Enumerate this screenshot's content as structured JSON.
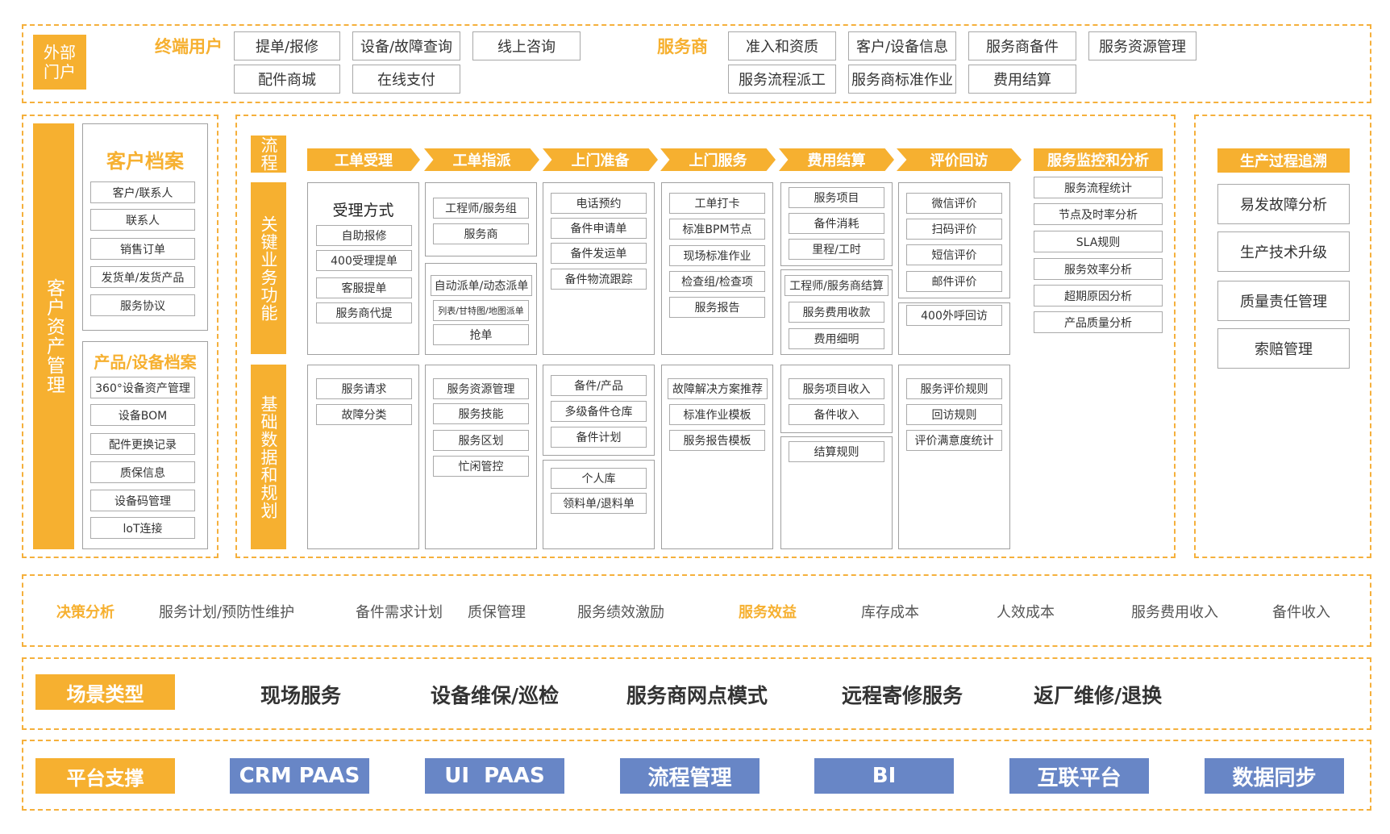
{
  "portal": {
    "label": "外部门户",
    "end_user": {
      "title": "终端用户",
      "items": [
        "提单/报修",
        "设备/故障查询",
        "线上咨询",
        "配件商城",
        "在线支付"
      ]
    },
    "provider": {
      "title": "服务商",
      "items": [
        "准入和资质",
        "客户/设备信息",
        "服务商备件",
        "服务资源管理",
        "服务流程派工",
        "服务商标准作业",
        "费用结算"
      ]
    }
  },
  "asset": {
    "label": "客户资产管理",
    "customer": {
      "title": "客户档案",
      "items": [
        "客户/联系人",
        "联系人",
        "销售订单",
        "发货单/发货产品",
        "服务协议"
      ]
    },
    "product": {
      "title": "产品/设备档案",
      "items": [
        "360°设备资产管理",
        "设备BOM",
        "配件更换记录",
        "质保信息",
        "设备码管理",
        "loT连接"
      ]
    }
  },
  "process": {
    "side_labels": [
      "流程",
      "关键业务功能",
      "基础数据和规划"
    ],
    "stages": [
      "工单受理",
      "工单指派",
      "上门准备",
      "上门服务",
      "费用结算",
      "评价回访"
    ],
    "key": {
      "c1": {
        "heading": "受理方式",
        "items": [
          "自助报修",
          "400受理提单",
          "客服提单",
          "服务商代提"
        ]
      },
      "c2": {
        "top": [
          "工程师/服务组",
          "服务商"
        ],
        "bottom": [
          "自动派单/动态派单",
          "列表/甘特图/地图派单",
          "抢单"
        ]
      },
      "c3": {
        "items": [
          "电话预约",
          "备件申请单",
          "备件发运单",
          "备件物流跟踪"
        ]
      },
      "c4": {
        "items": [
          "工单打卡",
          "标准BPM节点",
          "现场标准作业",
          "检查组/检查项",
          "服务报告"
        ]
      },
      "c5": {
        "top": [
          "服务项目",
          "备件消耗",
          "里程/工时"
        ],
        "bottom": [
          "工程师/服务商结算",
          "服务费用收款",
          "费用细明"
        ]
      },
      "c6": {
        "top": [
          "微信评价",
          "扫码评价",
          "短信评价",
          "邮件评价"
        ],
        "bottom": [
          "400外呼回访"
        ]
      }
    },
    "base": {
      "c1": {
        "items": [
          "服务请求",
          "故障分类"
        ]
      },
      "c2": {
        "items": [
          "服务资源管理",
          "服务技能",
          "服务区划",
          "忙闲管控"
        ]
      },
      "c3": {
        "top": [
          "备件/产品",
          "多级备件仓库",
          "备件计划"
        ],
        "bottom": [
          "个人库",
          "领料单/退料单"
        ]
      },
      "c4": {
        "items": [
          "故障解决方案推荐",
          "标准作业模板",
          "服务报告模板"
        ]
      },
      "c5": {
        "top": [
          "服务项目收入",
          "备件收入"
        ],
        "bottom": [
          "结算规则"
        ]
      },
      "c6": {
        "items": [
          "服务评价规则",
          "回访规则",
          "评价满意度统计"
        ]
      }
    },
    "monitor": {
      "title": "服务监控和分析",
      "items": [
        "服务流程统计",
        "节点及时率分析",
        "SLA规则",
        "服务效率分析",
        "超期原因分析",
        "产品质量分析"
      ]
    }
  },
  "trace": {
    "title": "生产过程追溯",
    "items": [
      "易发故障分析",
      "生产技术升级",
      "质量责任管理",
      "索赔管理"
    ]
  },
  "decision": {
    "label": "决策分析",
    "items": [
      "服务计划/预防性维护",
      "备件需求计划",
      "质保管理",
      "服务绩效激励"
    ],
    "benefit_label": "服务效益",
    "benefit_items": [
      "库存成本",
      "人效成本",
      "服务费用收入",
      "备件收入"
    ]
  },
  "scenario": {
    "label": "场景类型",
    "items": [
      "现场服务",
      "设备维保/巡检",
      "服务商网点模式",
      "远程寄修服务",
      "返厂维修/退换"
    ]
  },
  "platform": {
    "label": "平台支撑",
    "items": [
      "CRM PAAS",
      "UI  PAAS",
      "流程管理",
      "BI",
      "互联平台",
      "数据同步"
    ]
  },
  "colors": {
    "accent": "#f6b030",
    "blue": "#6886c6",
    "border": "#a8a8a8"
  }
}
